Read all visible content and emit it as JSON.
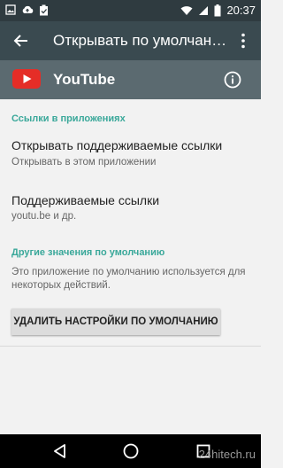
{
  "status_bar": {
    "time": "20:37"
  },
  "app_bar": {
    "title": "Открывать по умолчанию"
  },
  "app_row": {
    "app_name": "YouTube"
  },
  "links_section": {
    "header": "Ссылки в приложениях",
    "open_supported": {
      "title": "Открывать поддерживаемые ссылки",
      "subtitle": "Открывать в этом приложении"
    },
    "supported_links": {
      "title": "Поддерживаемые ссылки",
      "subtitle": "youtu.be и др."
    }
  },
  "defaults_section": {
    "header": "Другие значения по умолчанию",
    "description": "Это приложение по умолчанию используется для некоторых действий.",
    "clear_button": "УДАЛИТЬ НАСТРОЙКИ ПО УМОЛЧАНИЮ"
  },
  "watermark": "24hitech.ru",
  "colors": {
    "accent": "#3aa89a",
    "status_bar": "#2f3b40",
    "app_bar": "#3a4a50",
    "app_row": "#5b6a70",
    "youtube_red": "#e52d27"
  }
}
